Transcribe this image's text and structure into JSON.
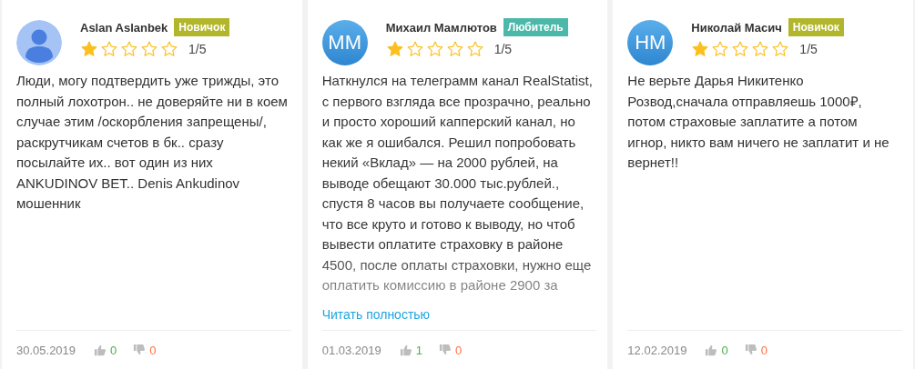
{
  "reviews": [
    {
      "author": "Aslan Aslanbek",
      "avatar": {
        "kind": "silhouette"
      },
      "badge": {
        "label": "Новичок",
        "color": "#b2b62a"
      },
      "stars": 1,
      "rating": "1/5",
      "text": "Люди, могу подтвердить уже трижды, это полный лохотрон.. не доверяйте ни в коем случае этим /оскорбления запрещены/, раскрутчикам счетов в бк.. сразу посылайте их.. вот один из них ANKUDINOV BET.. Denis Ankudinov мошенник",
      "truncated": false,
      "date": "30.05.2019",
      "likes": "0",
      "dislikes": "0"
    },
    {
      "author": "Михаил Мамлютов",
      "avatar": {
        "kind": "initials",
        "initials": "ММ"
      },
      "badge": {
        "label": "Любитель",
        "color": "#4cb8a9"
      },
      "stars": 1,
      "rating": "1/5",
      "text": "Наткнулся на телеграмм канал RealStatist, с первого взгляда все прозрачно, реально и просто хороший капперский канал, но как же я ошибался. Решил попробовать некий «Вклад» — на 2000 рублей, на выводе обещают 30.000 тыс.рублей., спустя 8 часов вы получаете сообщение, что все круто и готово к выводу, но чтоб вывести оплатите страховку в районе 4500, после оплаты страховки, нужно еще оплатить комиссию в районе 2900 за",
      "truncated": true,
      "read_more": "Читать полностью",
      "date": "01.03.2019",
      "likes": "1",
      "dislikes": "0"
    },
    {
      "author": "Николай Масич",
      "avatar": {
        "kind": "initials",
        "initials": "НМ"
      },
      "badge": {
        "label": "Новичок",
        "color": "#b2b62a"
      },
      "stars": 1,
      "rating": "1/5",
      "text": "Не верьте Дарья Никитенко\nРозвод,сначала отправляешь 1000₽, потом страховые заплатите а потом\nигнор, никто вам ничего не заплатит и не вернет!!",
      "truncated": false,
      "date": "12.02.2019",
      "likes": "0",
      "dislikes": "0"
    }
  ]
}
